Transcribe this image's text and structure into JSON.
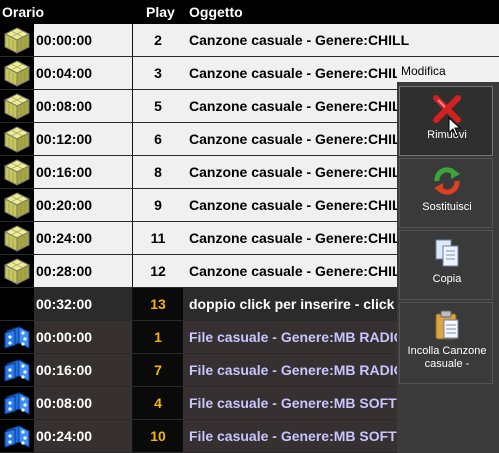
{
  "header": {
    "orario": "Orario",
    "play": "Play",
    "oggetto": "Oggetto"
  },
  "rows": [
    {
      "type": "light",
      "icon": "yellow-cube-icon",
      "time": "00:00:00",
      "play": "2",
      "object": "Canzone casuale - Genere:CHILL"
    },
    {
      "type": "light",
      "icon": "yellow-cube-icon",
      "time": "00:04:00",
      "play": "3",
      "object": "Canzone casuale - Genere:CHILL"
    },
    {
      "type": "light",
      "icon": "yellow-cube-icon",
      "time": "00:08:00",
      "play": "5",
      "object": "Canzone casuale - Genere:CHILL"
    },
    {
      "type": "light",
      "icon": "yellow-cube-icon",
      "time": "00:12:00",
      "play": "6",
      "object": "Canzone casuale - Genere:CHILL"
    },
    {
      "type": "light",
      "icon": "yellow-cube-icon",
      "time": "00:16:00",
      "play": "8",
      "object": "Canzone casuale - Genere:CHILL"
    },
    {
      "type": "light",
      "icon": "yellow-cube-icon",
      "time": "00:20:00",
      "play": "9",
      "object": "Canzone casuale - Genere:CHILL"
    },
    {
      "type": "light",
      "icon": "yellow-cube-icon",
      "time": "00:24:00",
      "play": "11",
      "object": "Canzone casuale - Genere:CHILL"
    },
    {
      "type": "light",
      "icon": "yellow-cube-icon",
      "time": "00:28:00",
      "play": "12",
      "object": "Canzone casuale - Genere:CHILL"
    },
    {
      "type": "dark",
      "icon": "",
      "time": "00:32:00",
      "play": "13",
      "object": "doppio click per inserire - click d"
    },
    {
      "type": "blue",
      "icon": "blue-dice-icon",
      "time": "00:00:00",
      "play": "1",
      "object": "File casuale  - Genere:MB RADIO"
    },
    {
      "type": "blue",
      "icon": "blue-dice-icon",
      "time": "00:16:00",
      "play": "7",
      "object": "File casuale  - Genere:MB RADIO"
    },
    {
      "type": "blue",
      "icon": "blue-dice-icon",
      "time": "00:08:00",
      "play": "4",
      "object": "File casuale  - Genere:MB SOFT"
    },
    {
      "type": "blue",
      "icon": "blue-dice-icon",
      "time": "00:24:00",
      "play": "10",
      "object": "File casuale  - Genere:MB SOFT"
    }
  ],
  "menu": {
    "title": "Modifica",
    "items": [
      {
        "label": "Rimuovi",
        "icon": "remove-x-icon"
      },
      {
        "label": "Sostituisci",
        "icon": "replace-arrows-icon"
      },
      {
        "label": "Copia",
        "icon": "copy-icon"
      },
      {
        "label": "Incolla Canzone casuale - Genere:CHILL",
        "icon": "paste-icon"
      }
    ]
  },
  "colors": {
    "play_highlight": "#f7b600",
    "blue_text": "#c9c6ff"
  }
}
